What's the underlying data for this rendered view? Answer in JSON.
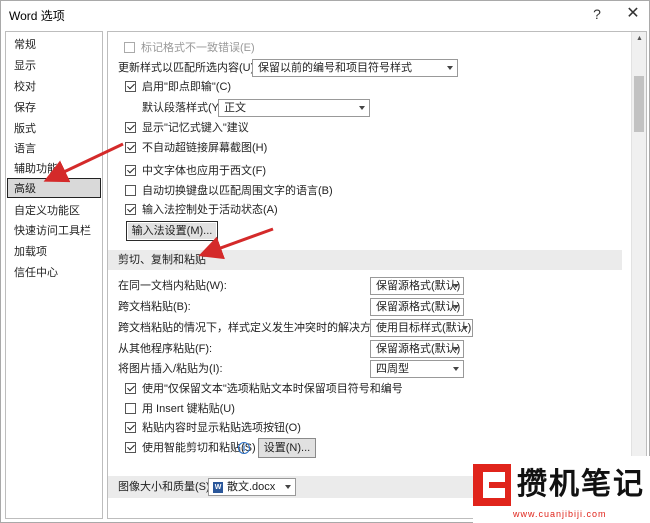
{
  "window": {
    "title": "Word 选项",
    "help_glyph": "?",
    "close_glyph": "✕"
  },
  "sidebar": {
    "items": [
      {
        "label": "常规"
      },
      {
        "label": "显示"
      },
      {
        "label": "校对"
      },
      {
        "label": "保存"
      },
      {
        "label": "版式"
      },
      {
        "label": "语言"
      },
      {
        "label": "辅助功能"
      },
      {
        "label": "高级",
        "active": true
      },
      {
        "label": "自定义功能区"
      },
      {
        "label": "快速访问工具栏"
      },
      {
        "label": "加载项"
      },
      {
        "label": "信任中心"
      }
    ]
  },
  "editing": {
    "mark_format_inconsistencies": {
      "label": "标记格式不一致错误(E)",
      "checked": false,
      "disabled": true
    },
    "update_style_label": "更新样式以匹配所选内容(U):",
    "update_style_value": "保留以前的编号和项目符号样式",
    "click_and_type": {
      "label": "启用\"即点即输\"(C)",
      "checked": true
    },
    "default_paragraph_style_label": "默认段落样式(Y):",
    "default_paragraph_style_value": "正文",
    "autocomplete": {
      "label": "显示\"记忆式键入\"建议",
      "checked": true
    },
    "no_auto_hyperlink_screenshot": {
      "label": "不自动超链接屏幕截图(H)",
      "checked": true
    },
    "chinese_font_western": {
      "label": "中文字体也应用于西文(F)",
      "checked": true
    },
    "auto_switch_keyboard": {
      "label": "自动切换键盘以匹配周围文字的语言(B)",
      "checked": false
    },
    "ime_control_active": {
      "label": "输入法控制处于活动状态(A)",
      "checked": true
    },
    "ime_settings_button": "输入法设置(M)..."
  },
  "paste": {
    "section_title": "剪切、复制和粘贴",
    "rows": [
      {
        "label": "在同一文档内粘贴(W):",
        "value": "保留源格式(默认)"
      },
      {
        "label": "跨文档粘贴(B):",
        "value": "保留源格式(默认)"
      },
      {
        "label": "跨文档粘贴的情况下，样式定义发生冲突时的解决方法(E):",
        "value": "使用目标样式(默认)"
      },
      {
        "label": "从其他程序粘贴(F):",
        "value": "保留源格式(默认)"
      },
      {
        "label": "将图片插入/粘贴为(I):",
        "value": "四周型"
      }
    ],
    "keep_bullets": {
      "label": "使用\"仅保留文本\"选项粘贴文本时保留项目符号和编号",
      "checked": true
    },
    "insert_key_paste": {
      "label": "用 Insert 键粘贴(U)",
      "checked": false
    },
    "show_paste_options": {
      "label": "粘贴内容时显示粘贴选项按钮(O)",
      "checked": true
    },
    "smart_cut_paste": {
      "label": "使用智能剪切和粘贴(S)",
      "checked": true
    },
    "settings_button": "设置(N)...",
    "info_glyph": "i"
  },
  "image_section": {
    "title": "图像大小和质量(S)",
    "document": "散文.docx",
    "doc_icon": "W"
  },
  "watermark": {
    "text": "攒机笔记",
    "url": "www.cuanjibiji.com"
  },
  "colors": {
    "annotation_arrow": "#d42a2a",
    "watermark_red": "#e0241b"
  }
}
